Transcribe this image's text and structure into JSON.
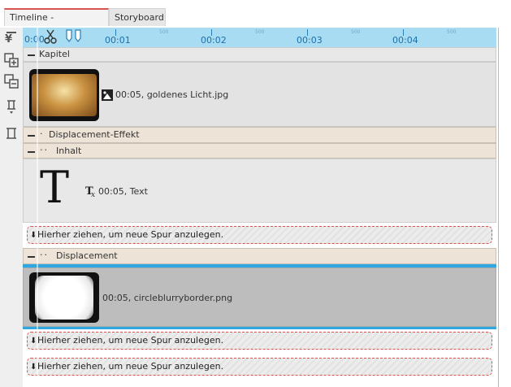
{
  "tabs": [
    {
      "label": "Timeline - Spuransicht",
      "active": true
    },
    {
      "label": "Storyboard",
      "active": false
    }
  ],
  "ruler": {
    "position": "0:00",
    "major_labels": [
      "00:01",
      "00:02",
      "00:03",
      "00:04"
    ],
    "minor_label": "500"
  },
  "sections": {
    "kapitel": {
      "label": "Kapitel"
    },
    "displacement_effekt": {
      "label": "Displacement-Effekt"
    },
    "inhalt": {
      "label": "Inhalt"
    },
    "displacement": {
      "label": "Displacement"
    }
  },
  "clips": {
    "image1": {
      "info": "00:05, goldenes Licht.jpg",
      "icon": "image-icon"
    },
    "text1": {
      "glyph": "T",
      "info": "00:05, Text",
      "icon": "text-fx-icon"
    },
    "image2": {
      "info": "00:05, circleblurryborder.png"
    }
  },
  "drop_zone_label": "Hierher ziehen, um neue Spur anzulegen.",
  "colors": {
    "accent_tab": "#d9534f",
    "ruler": "#a8dcf2",
    "selection_blue": "#2fa7e0",
    "section_bg": "#ede3d6",
    "drop_border": "#d9534f"
  }
}
